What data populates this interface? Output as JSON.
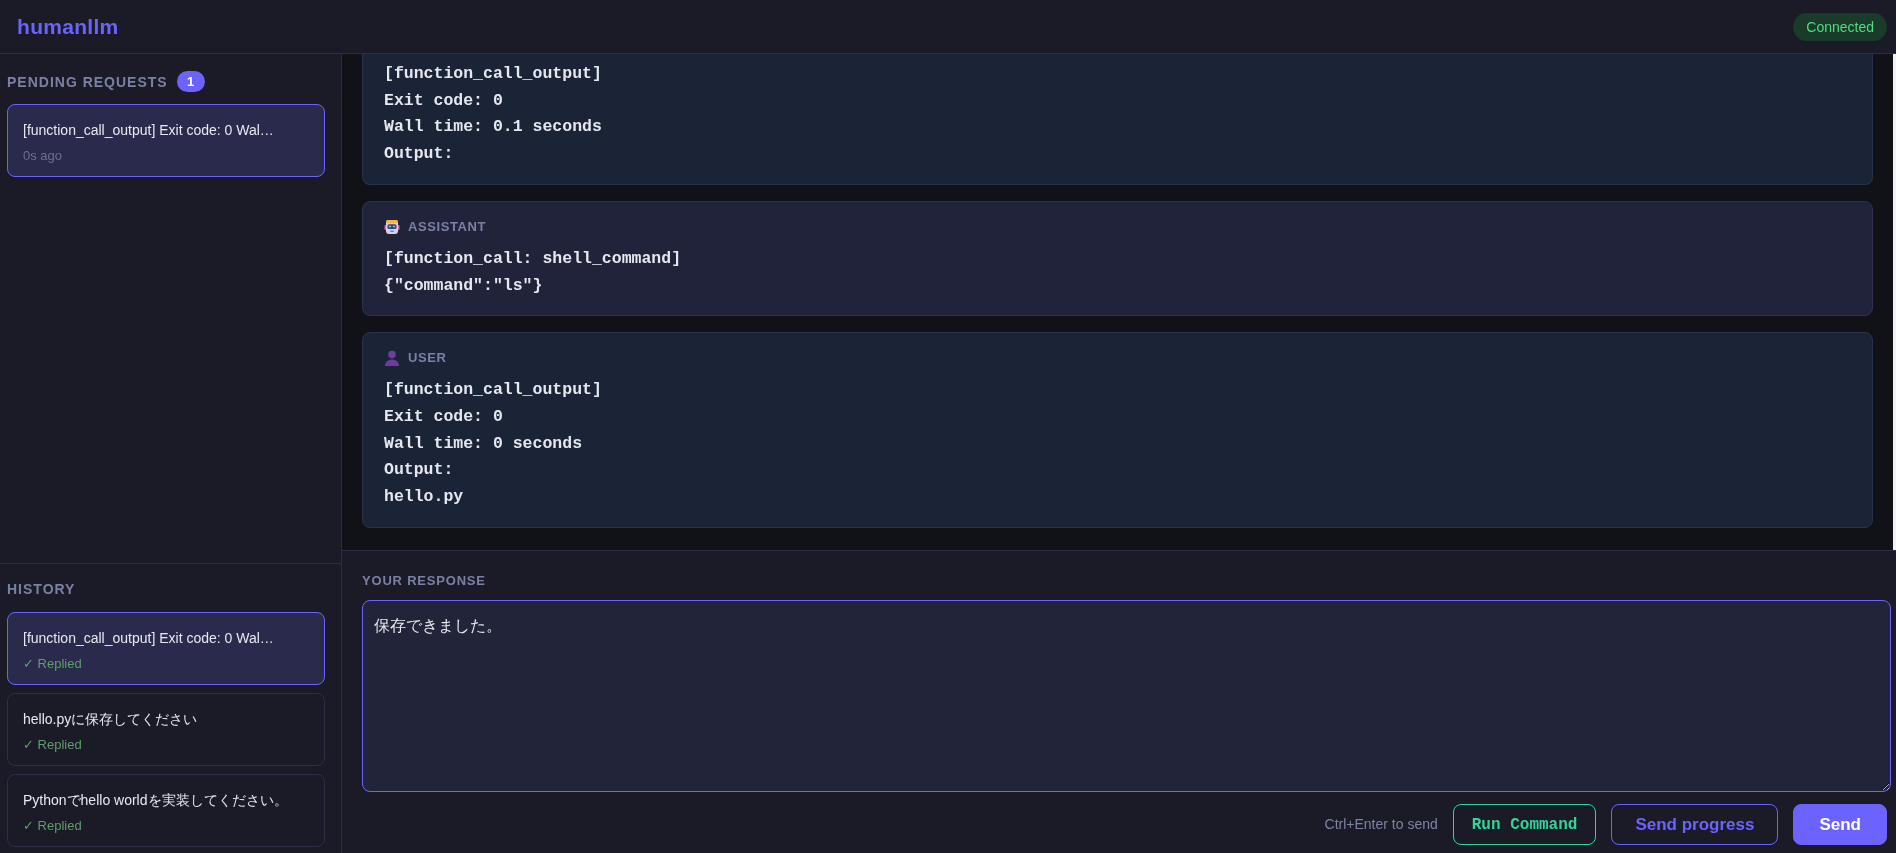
{
  "header": {
    "logo": "humanllm",
    "connection": "Connected"
  },
  "sidebar": {
    "pending": {
      "title": "PENDING REQUESTS",
      "count": "1",
      "items": [
        {
          "text": "[function_call_output] Exit code: 0 Wal…",
          "time": "0s ago",
          "selected": true
        }
      ]
    },
    "history": {
      "title": "HISTORY",
      "items": [
        {
          "text": "[function_call_output] Exit code: 0 Wal…",
          "status": "✓ Replied",
          "selected": true
        },
        {
          "text": "hello.pyに保存してください",
          "status": "✓ Replied",
          "selected": false
        },
        {
          "text": "Pythonでhello worldを実装してください。",
          "status": "✓ Replied",
          "selected": false
        }
      ]
    }
  },
  "messages": [
    {
      "kind": "user",
      "lines": [
        "[function_call_output]",
        "Exit code: 0",
        "Wall time: 0.1 seconds",
        "Output:"
      ]
    },
    {
      "kind": "assistant",
      "role": "ASSISTANT",
      "lines": [
        "[function_call: shell_command]",
        "{\"command\":\"ls\"}"
      ]
    },
    {
      "kind": "user",
      "role": "USER",
      "lines": [
        "[function_call_output]",
        "Exit code: 0",
        "Wall time: 0 seconds",
        "Output:",
        "hello.py"
      ]
    }
  ],
  "response": {
    "label": "YOUR RESPONSE",
    "value": "保存できました。",
    "hint": "Ctrl+Enter to send",
    "buttons": [
      {
        "label": "Run Command",
        "kind": "command"
      },
      {
        "label": "Send progress",
        "kind": "secondary"
      },
      {
        "label": "Send",
        "kind": "primary"
      }
    ]
  }
}
